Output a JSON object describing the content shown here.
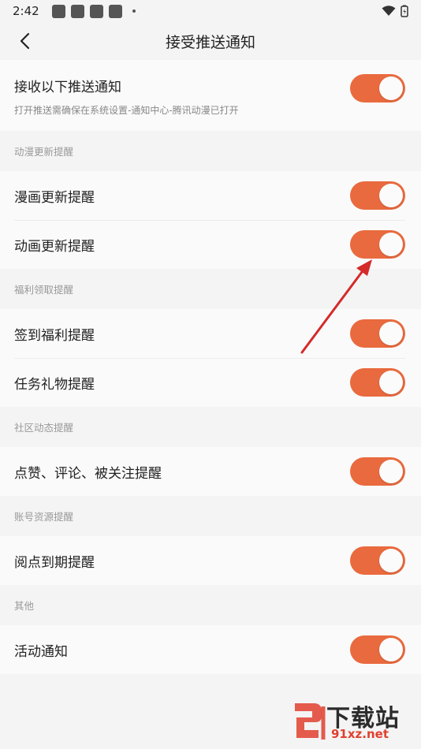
{
  "status_bar": {
    "time": "2:42"
  },
  "nav": {
    "title": "接受推送通知"
  },
  "master": {
    "title": "接收以下推送通知",
    "subtitle": "打开推送需确保在系统设置-通知中心-腾讯动漫已打开",
    "on": true
  },
  "sections": [
    {
      "header": "动漫更新提醒",
      "items": [
        {
          "label": "漫画更新提醒",
          "on": true
        },
        {
          "label": "动画更新提醒",
          "on": true
        }
      ]
    },
    {
      "header": "福利领取提醒",
      "items": [
        {
          "label": "签到福利提醒",
          "on": true
        },
        {
          "label": "任务礼物提醒",
          "on": true
        }
      ]
    },
    {
      "header": "社区动态提醒",
      "items": [
        {
          "label": "点赞、评论、被关注提醒",
          "on": true
        }
      ]
    },
    {
      "header": "账号资源提醒",
      "items": [
        {
          "label": "阅点到期提醒",
          "on": true
        }
      ]
    },
    {
      "header": "其他",
      "items": [
        {
          "label": "活动通知",
          "on": true
        }
      ]
    }
  ],
  "colors": {
    "toggle_on": "#e96a3e",
    "arrow": "#d42a2a",
    "background": "#f4f4f4"
  },
  "watermark": {
    "text": "下载站",
    "url": "91xz.net"
  }
}
